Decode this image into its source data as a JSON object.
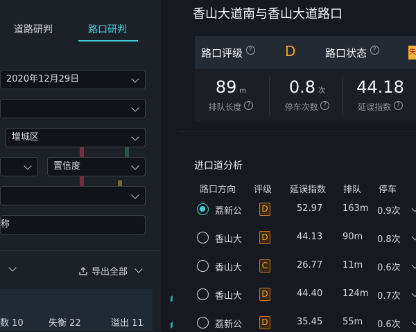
{
  "tabs": [
    {
      "label": "道路研判"
    },
    {
      "label": "路口研判"
    }
  ],
  "filters": {
    "date": "2020年12月29日",
    "select2": "",
    "district": "增城区",
    "select4a": "",
    "confidence": "置信度",
    "select5": "",
    "name_input": "称"
  },
  "export_label": "导出全部",
  "summary": [
    {
      "text": "数 10"
    },
    {
      "text": "失衡 22"
    },
    {
      "text": "溢出 11"
    }
  ],
  "intersection": {
    "title": "香山大道南与香山大道路口",
    "grade_label": "路口评级",
    "grade": "D",
    "status_label": "路口状态",
    "status": "失"
  },
  "metrics": [
    {
      "value": "89",
      "unit": "m",
      "label": "排队长度"
    },
    {
      "value": "0.8",
      "unit": "次",
      "label": "停车次数"
    },
    {
      "value": "44.18",
      "unit": "",
      "label": "延误指数"
    }
  ],
  "approach": {
    "title": "进口道分析",
    "headers": [
      "路口方向",
      "评级",
      "延误指数",
      "排队",
      "停车"
    ],
    "rows": [
      {
        "dir": "荔新公",
        "grade": "D",
        "delay": "52.97",
        "queue": "163m",
        "stops": "0.9次",
        "selected": true
      },
      {
        "dir": "香山大",
        "grade": "D",
        "delay": "44.13",
        "queue": "90m",
        "stops": "0.8次",
        "selected": false
      },
      {
        "dir": "香山大",
        "grade": "C",
        "delay": "26.77",
        "queue": "11m",
        "stops": "0.6次",
        "selected": false
      },
      {
        "dir": "香山大",
        "grade": "D",
        "delay": "44.40",
        "queue": "124m",
        "stops": "0.7次",
        "selected": false
      },
      {
        "dir": "荔新公",
        "grade": "D",
        "delay": "35.45",
        "queue": "55m",
        "stops": "0.6次",
        "selected": false
      }
    ]
  },
  "colors": {
    "accent": "#3fd0d8",
    "grade": "#f0a227",
    "panel": "#1c2027"
  }
}
